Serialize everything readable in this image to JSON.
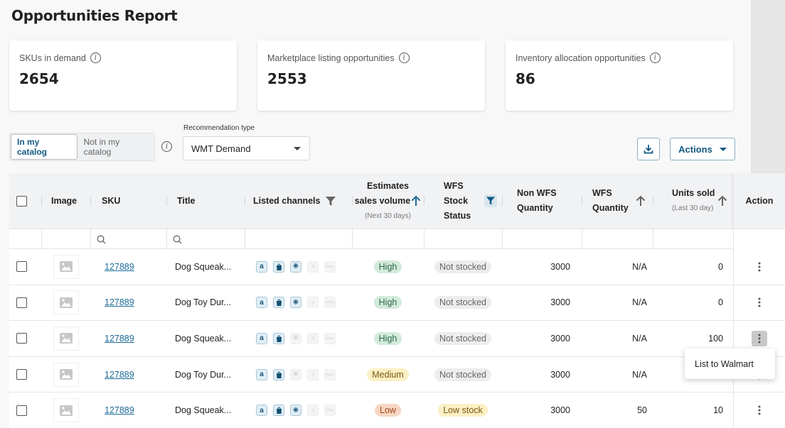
{
  "page": {
    "title": "Opportunities Report"
  },
  "cards": [
    {
      "label": "SKUs in demand",
      "value": "2654",
      "icon": "info-icon"
    },
    {
      "label": "Marketplace listing opportunities",
      "value": "2553",
      "icon": "info-icon"
    },
    {
      "label": "Inventory allocation opportunities",
      "value": "86",
      "icon": "info-icon"
    }
  ],
  "filters": {
    "catalog_toggle": {
      "options": [
        "In my catalog",
        "Not in my catalog"
      ],
      "selected": "In my catalog"
    },
    "recommendation_type": {
      "label": "Recommendation type",
      "value": "WMT Demand"
    }
  },
  "toolbar": {
    "download_icon": "download-icon",
    "actions_label": "Actions"
  },
  "table": {
    "columns": {
      "image": "Image",
      "sku": "SKU",
      "title": "Title",
      "listed_channels": "Listed channels",
      "est_sales_1": "Estimates",
      "est_sales_2": "sales volume",
      "est_sales_sub": "(Next 30 days)",
      "wfs_stock_1": "WFS",
      "wfs_stock_2": "Stock",
      "wfs_stock_3": "Status",
      "non_wfs_1": "Non WFS",
      "non_wfs_2": "Quantity",
      "wfs_qty_1": "WFS",
      "wfs_qty_2": "Quantity",
      "units_sold": "Units sold",
      "units_sold_sub": "(Last 30 day)",
      "action": "Action"
    },
    "channel_names": [
      "amazon",
      "shopify",
      "walmart",
      "tiktok",
      "ebay"
    ],
    "rows": [
      {
        "sku": "127889",
        "title": "Dog Squeak...",
        "channels": [
          true,
          true,
          true,
          false,
          false
        ],
        "sales_volume": "High",
        "wfs_status": "Not stocked",
        "non_wfs_qty": "3000",
        "wfs_qty": "N/A",
        "units_sold": "0"
      },
      {
        "sku": "127889",
        "title": "Dog Toy Dur...",
        "channels": [
          true,
          true,
          true,
          false,
          false
        ],
        "sales_volume": "High",
        "wfs_status": "Not stocked",
        "non_wfs_qty": "3000",
        "wfs_qty": "N/A",
        "units_sold": "0"
      },
      {
        "sku": "127889",
        "title": "Dog Squeak...",
        "channels": [
          true,
          true,
          false,
          false,
          false
        ],
        "sales_volume": "High",
        "wfs_status": "Not stocked",
        "non_wfs_qty": "3000",
        "wfs_qty": "N/A",
        "units_sold": "100"
      },
      {
        "sku": "127889",
        "title": "Dog Toy Dur...",
        "channels": [
          true,
          true,
          false,
          false,
          false
        ],
        "sales_volume": "Medium",
        "wfs_status": "Not stocked",
        "non_wfs_qty": "3000",
        "wfs_qty": "N/A",
        "units_sold": ""
      },
      {
        "sku": "127889",
        "title": "Dog Squeak...",
        "channels": [
          true,
          true,
          true,
          false,
          false
        ],
        "sales_volume": "Low",
        "wfs_status": "Low stock",
        "non_wfs_qty": "3000",
        "wfs_qty": "50",
        "units_sold": "10"
      }
    ]
  },
  "badge_colors": {
    "High": {
      "bg": "#d3eadd",
      "fg": "#2b6a45"
    },
    "Medium": {
      "bg": "#fbefc4",
      "fg": "#7a5a10"
    },
    "Low": {
      "bg": "#f6d6c2",
      "fg": "#a24417"
    },
    "Not stocked": {
      "bg": "#eceded",
      "fg": "#666666"
    },
    "Low stock": {
      "bg": "#fbefc4",
      "fg": "#7a5a10"
    }
  },
  "context_menu": {
    "open_on_row": 2,
    "items": [
      "List to Walmart"
    ]
  },
  "colors": {
    "accent": "#135a84",
    "link": "#1b6a97"
  }
}
